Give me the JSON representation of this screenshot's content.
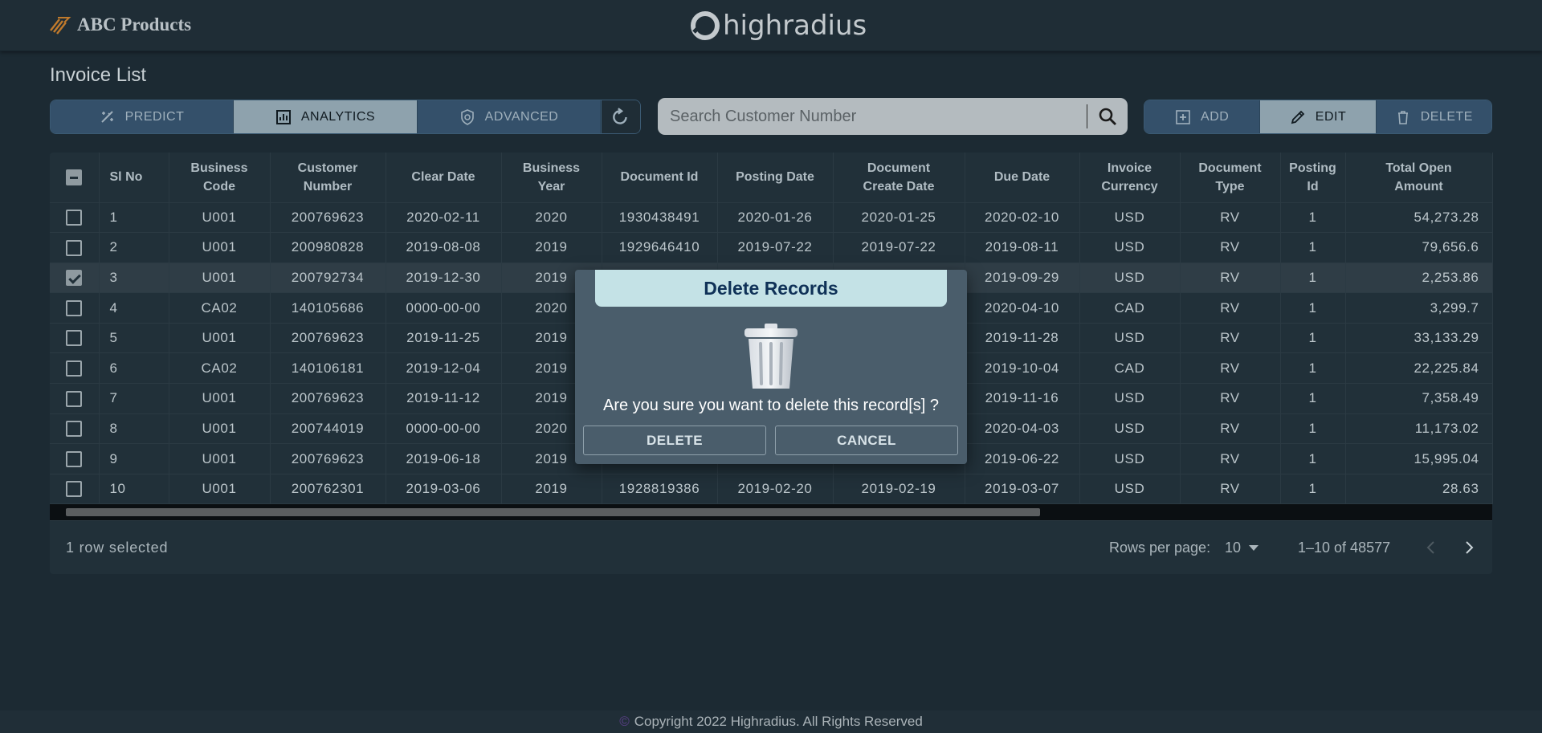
{
  "header": {
    "brand_name": "ABC Products",
    "logo_text": "highradius"
  },
  "page": {
    "title": "Invoice List"
  },
  "toolbar": {
    "left_buttons": [
      {
        "label": "PREDICT",
        "icon": "predict-icon",
        "active": false
      },
      {
        "label": "ANALYTICS",
        "icon": "analytics-icon",
        "active": true
      },
      {
        "label": "ADVANCED",
        "icon": "advanced-search-icon",
        "active": false
      }
    ],
    "refresh_icon": "refresh-icon",
    "search": {
      "placeholder": "Search Customer Number",
      "value": ""
    },
    "right_buttons": [
      {
        "label": "ADD",
        "icon": "add-icon",
        "active": false
      },
      {
        "label": "EDIT",
        "icon": "edit-icon",
        "active": true
      },
      {
        "label": "DELETE",
        "icon": "delete-icon",
        "active": false
      }
    ]
  },
  "table": {
    "columns": [
      "Sl No",
      "Business Code",
      "Customer Number",
      "Clear Date",
      "Business Year",
      "Document Id",
      "Posting Date",
      "Document Create Date",
      "Due Date",
      "Invoice Currency",
      "Document Type",
      "Posting Id",
      "Total Open Amount"
    ],
    "header_lines": [
      [
        "Sl No"
      ],
      [
        "Business",
        "Code"
      ],
      [
        "Customer",
        "Number"
      ],
      [
        "Clear Date"
      ],
      [
        "Business",
        "Year"
      ],
      [
        "Document Id"
      ],
      [
        "Posting Date"
      ],
      [
        "Document",
        "Create Date"
      ],
      [
        "Due Date"
      ],
      [
        "Invoice",
        "Currency"
      ],
      [
        "Document",
        "Type"
      ],
      [
        "Posting",
        "Id"
      ],
      [
        "Total Open",
        "Amount"
      ]
    ],
    "rows": [
      {
        "selected": false,
        "cells": [
          "1",
          "U001",
          "200769623",
          "2020-02-11",
          "2020",
          "1930438491",
          "2020-01-26",
          "2020-01-25",
          "2020-02-10",
          "USD",
          "RV",
          "1",
          "54,273.28"
        ]
      },
      {
        "selected": false,
        "cells": [
          "2",
          "U001",
          "200980828",
          "2019-08-08",
          "2019",
          "1929646410",
          "2019-07-22",
          "2019-07-22",
          "2019-08-11",
          "USD",
          "RV",
          "1",
          "79,656.6"
        ]
      },
      {
        "selected": true,
        "cells": [
          "3",
          "U001",
          "200792734",
          "2019-12-30",
          "2019",
          "",
          "",
          "",
          "2019-09-29",
          "USD",
          "RV",
          "1",
          "2,253.86"
        ]
      },
      {
        "selected": false,
        "cells": [
          "4",
          "CA02",
          "140105686",
          "0000-00-00",
          "2020",
          "",
          "",
          "",
          "2020-04-10",
          "CAD",
          "RV",
          "1",
          "3,299.7"
        ]
      },
      {
        "selected": false,
        "cells": [
          "5",
          "U001",
          "200769623",
          "2019-11-25",
          "2019",
          "",
          "",
          "",
          "2019-11-28",
          "USD",
          "RV",
          "1",
          "33,133.29"
        ]
      },
      {
        "selected": false,
        "cells": [
          "6",
          "CA02",
          "140106181",
          "2019-12-04",
          "2019",
          "",
          "",
          "",
          "2019-10-04",
          "CAD",
          "RV",
          "1",
          "22,225.84"
        ]
      },
      {
        "selected": false,
        "cells": [
          "7",
          "U001",
          "200769623",
          "2019-11-12",
          "2019",
          "",
          "",
          "",
          "2019-11-16",
          "USD",
          "RV",
          "1",
          "7,358.49"
        ]
      },
      {
        "selected": false,
        "cells": [
          "8",
          "U001",
          "200744019",
          "0000-00-00",
          "2020",
          "",
          "",
          "",
          "2020-04-03",
          "USD",
          "RV",
          "1",
          "11,173.02"
        ]
      },
      {
        "selected": false,
        "cells": [
          "9",
          "U001",
          "200769623",
          "2019-06-18",
          "2019",
          "",
          "",
          "",
          "2019-06-22",
          "USD",
          "RV",
          "1",
          "15,995.04"
        ]
      },
      {
        "selected": false,
        "cells": [
          "10",
          "U001",
          "200762301",
          "2019-03-06",
          "2019",
          "1928819386",
          "2019-02-20",
          "2019-02-19",
          "2019-03-07",
          "USD",
          "RV",
          "1",
          "28.63"
        ]
      }
    ]
  },
  "pagination": {
    "selected_text": "1 row selected",
    "rows_per_page_label": "Rows per page:",
    "rows_per_page_value": "10",
    "range_text": "1–10 of 48577"
  },
  "modal": {
    "title": "Delete Records",
    "icon": "trash-icon",
    "message": "Are you sure you want to delete this record[s] ?",
    "confirm_label": "DELETE",
    "cancel_label": "CANCEL"
  },
  "footer": {
    "copyright_symbol": "©",
    "copyright_text": "Copyright 2022 Highradius. All Rights Reserved"
  },
  "colors": {
    "background": "#1c2a33",
    "segment_button": "#34506a",
    "segment_active": "#8ea2ad",
    "modal_bg": "#4a5d6b",
    "modal_header": "#c4e2e6",
    "modal_title": "#0f3157"
  }
}
